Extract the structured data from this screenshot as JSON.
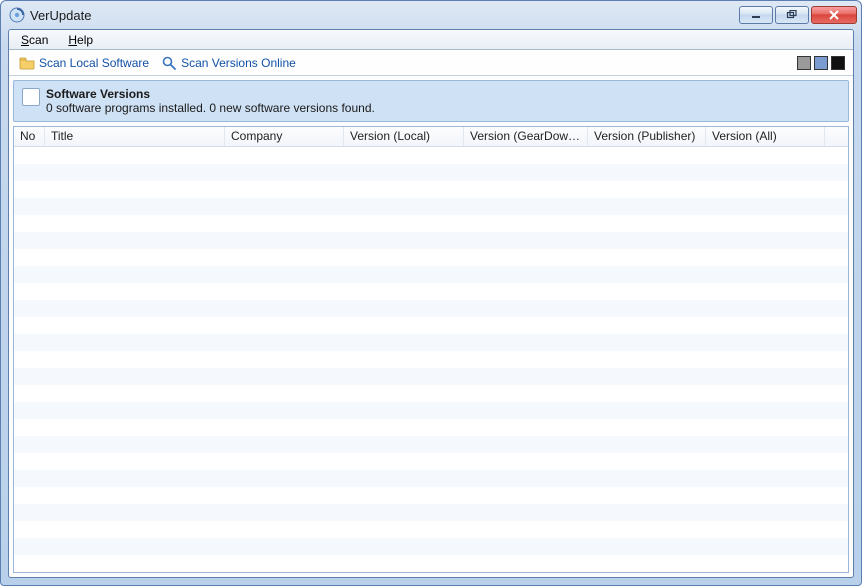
{
  "window": {
    "title": "VerUpdate"
  },
  "menu": {
    "scan": "Scan",
    "help": "Help"
  },
  "toolbar": {
    "scan_local": "Scan Local Software",
    "scan_online": "Scan Versions Online"
  },
  "swatch_colors": {
    "gray": "#9a9a9a",
    "blue": "#7b9cd0",
    "black": "#111111"
  },
  "info": {
    "heading": "Software Versions",
    "status": "0 software programs installed. 0 new software versions found."
  },
  "columns": {
    "no": "No",
    "title": "Title",
    "company": "Company",
    "version_local": "Version (Local)",
    "version_geardownload": "Version (GearDownload)",
    "version_publisher": "Version (Publisher)",
    "version_all": "Version (All)"
  },
  "rows": []
}
